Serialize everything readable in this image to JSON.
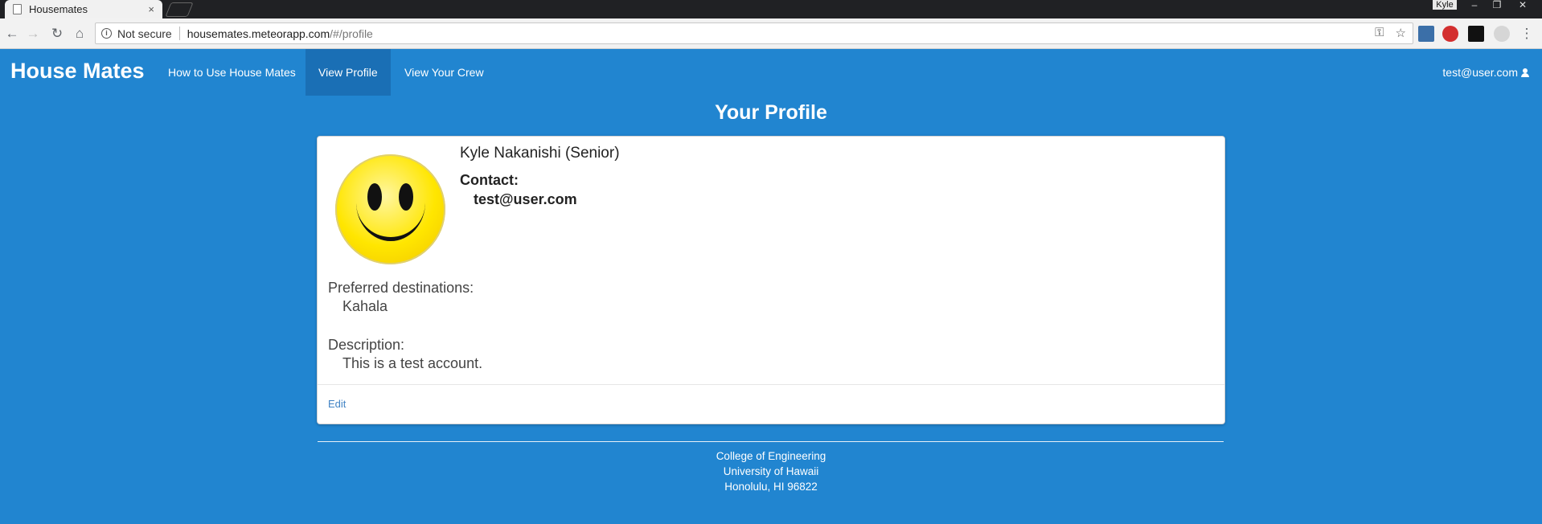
{
  "browser": {
    "tab_title": "Housemates",
    "tab_close": "×",
    "profile_name": "Kyle",
    "security_label": "Not secure",
    "url_host": "housemates.meteorapp.com",
    "url_path": "/#/profile"
  },
  "navbar": {
    "brand": "House Mates",
    "items": [
      {
        "label": "How to Use House Mates"
      },
      {
        "label": "View Profile",
        "active": true
      },
      {
        "label": "View Your Crew"
      }
    ],
    "user_email": "test@user.com"
  },
  "page": {
    "title": "Your Profile"
  },
  "profile": {
    "name": "Kyle Nakanishi (Senior)",
    "contact_label": "Contact:",
    "contact_email": "test@user.com",
    "destinations_label": "Preferred destinations:",
    "destinations_value": "Kahala",
    "description_label": "Description:",
    "description_value": "This is a test account.",
    "edit_label": "Edit"
  },
  "footer": {
    "line1": "College of Engineering",
    "line2": "University of Hawaii",
    "line3": "Honolulu, HI 96822"
  },
  "colors": {
    "primary": "#2185d0",
    "active_nav": "#1a6fb5",
    "link": "#4183c4"
  }
}
